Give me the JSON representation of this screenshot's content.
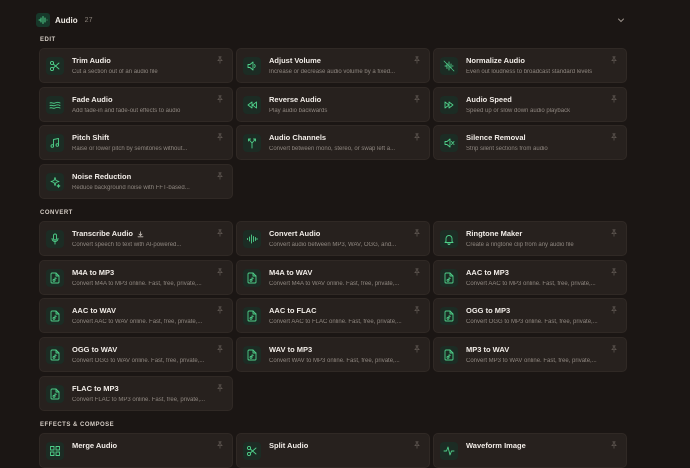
{
  "header": {
    "title": "Audio",
    "count": "27"
  },
  "sections": [
    {
      "title": "EDIT"
    },
    {
      "title": "CONVERT"
    },
    {
      "title": "EFFECTS & COMPOSE"
    }
  ],
  "tools": [
    {
      "title": "Trim Audio",
      "desc": "Cut a section out of an audio file",
      "icon": "scissors-icon"
    },
    {
      "title": "Adjust Volume",
      "desc": "Increase or decrease audio volume by a fixed...",
      "icon": "volume-icon"
    },
    {
      "title": "Normalize Audio",
      "desc": "Even out loudness to broadcast standard levels",
      "icon": "normalize-icon"
    },
    {
      "title": "Fade Audio",
      "desc": "Add fade-in and fade-out effects to audio",
      "icon": "waves-icon"
    },
    {
      "title": "Reverse Audio",
      "desc": "Play audio backwards",
      "icon": "rewind-icon"
    },
    {
      "title": "Audio Speed",
      "desc": "Speed up or slow down audio playback",
      "icon": "fast-forward-icon"
    },
    {
      "title": "Pitch Shift",
      "desc": "Raise or lower pitch by semitones without...",
      "icon": "music-note-icon"
    },
    {
      "title": "Audio Channels",
      "desc": "Convert between mono, stereo, or swap left a...",
      "icon": "split-channels-icon"
    },
    {
      "title": "Silence Removal",
      "desc": "Strip silent sections from audio",
      "icon": "mute-icon"
    },
    {
      "title": "Noise Reduction",
      "desc": "Reduce background noise with FFT-based...",
      "icon": "sparkles-icon"
    },
    {
      "title": "Transcribe Audio",
      "desc": "Convert speech to text with AI-powered...",
      "icon": "microphone-icon"
    },
    {
      "title": "Convert Audio",
      "desc": "Convert audio between MP3, WAV, OGG, and...",
      "icon": "audio-lines-icon"
    },
    {
      "title": "Ringtone Maker",
      "desc": "Create a ringtone clip from any audio file",
      "icon": "bell-icon"
    },
    {
      "title": "M4A to MP3",
      "desc": "Convert M4A to MP3 online. Fast, free, private,...",
      "icon": "file-audio-icon"
    },
    {
      "title": "M4A to WAV",
      "desc": "Convert M4A to WAV online. Fast, free, private,...",
      "icon": "file-audio-icon"
    },
    {
      "title": "AAC to MP3",
      "desc": "Convert AAC to MP3 online. Fast, free, private,...",
      "icon": "file-audio-icon"
    },
    {
      "title": "AAC to WAV",
      "desc": "Convert AAC to WAV online. Fast, free, private,...",
      "icon": "file-audio-icon"
    },
    {
      "title": "AAC to FLAC",
      "desc": "Convert AAC to FLAC online. Fast, free, private,...",
      "icon": "file-audio-icon"
    },
    {
      "title": "OGG to MP3",
      "desc": "Convert OGG to MP3 online. Fast, free, private,...",
      "icon": "file-audio-icon"
    },
    {
      "title": "OGG to WAV",
      "desc": "Convert OGG to WAV online. Fast, free, private,...",
      "icon": "file-audio-icon"
    },
    {
      "title": "WAV to MP3",
      "desc": "Convert WAV to MP3 online. Fast, free, private,...",
      "icon": "file-audio-icon"
    },
    {
      "title": "MP3 to WAV",
      "desc": "Convert MP3 to WAV online. Fast, free, private,...",
      "icon": "file-audio-icon"
    },
    {
      "title": "FLAC to MP3",
      "desc": "Convert FLAC to MP3 online. Fast, free, private,...",
      "icon": "file-audio-icon"
    },
    {
      "title": "Merge Audio",
      "desc": "",
      "icon": "grid-icon"
    },
    {
      "title": "Split Audio",
      "desc": "",
      "icon": "scissors-icon"
    },
    {
      "title": "Waveform Image",
      "desc": "",
      "icon": "activity-icon"
    }
  ],
  "colors": {
    "accent": "#4fd08a",
    "background": "#1b1614",
    "card": "#27211e"
  }
}
